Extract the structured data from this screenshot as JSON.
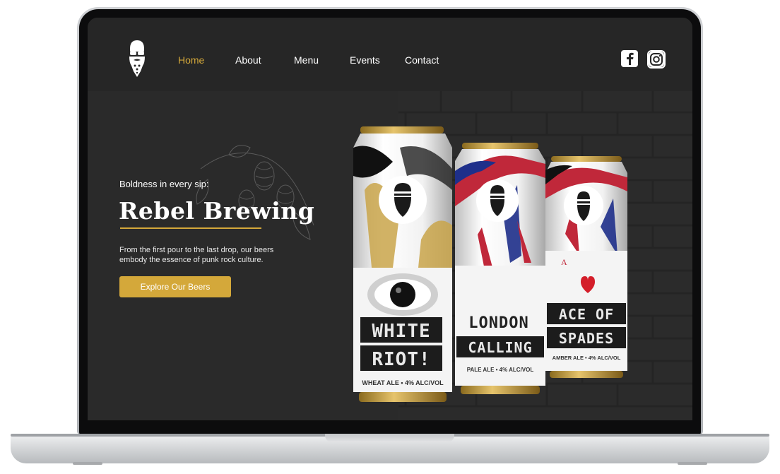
{
  "nav": {
    "links": [
      "Home",
      "About",
      "Menu",
      "Events",
      "Contact"
    ],
    "active": "Home"
  },
  "social": {
    "facebook_icon": "facebook-icon",
    "instagram_icon": "instagram-icon"
  },
  "hero": {
    "tagline": "Boldness in every sip:",
    "title": "Rebel Brewing",
    "description": "From the first pour to the last drop, our beers embody the essence of punk rock culture.",
    "cta_label": "Explore Our Beers"
  },
  "cans": [
    {
      "name_line1": "WHITE",
      "name_line2": "RIOT!",
      "style_text": "WHEAT ALE • 4% ALC/VOL"
    },
    {
      "name_line1": "LONDON",
      "name_line2": "CALLING",
      "style_text": "PALE ALE • 4% ALC/VOL"
    },
    {
      "name_line1": "ACE OF",
      "name_line2": "SPADES",
      "style_text": "AMBER ALE • 4% ALC/VOL",
      "card_rank": "A"
    }
  ],
  "colors": {
    "accent": "#d4a83a",
    "background": "#262626",
    "text": "#ffffff"
  }
}
